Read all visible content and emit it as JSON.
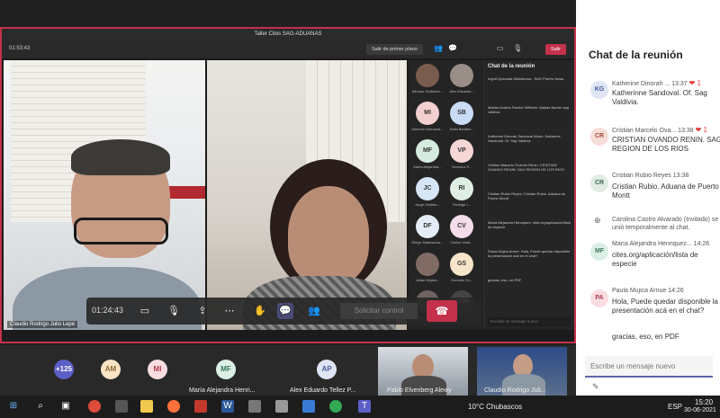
{
  "meeting_window": {
    "title": "Taller Cites SAG-ADUANAS",
    "timer": "01:53:43",
    "exit_fullscreen_label": "Salir de primer plano",
    "leave_label": "Salir"
  },
  "videos": {
    "left_name": "Claudio Rodrigo Julio Lepe",
    "right_name": ""
  },
  "controls": {
    "duration": "01:24:43",
    "request_control_label": "Solicitar control"
  },
  "gallery": {
    "tiles": [
      {
        "initials": "",
        "name": "Alfonso Gutierrez..."
      },
      {
        "initials": "",
        "name": "Alex Eduardo..."
      },
      {
        "initials": "MI",
        "name": "Marcela Hormazá..."
      },
      {
        "initials": "SB",
        "name": "Sofia Benitez..."
      },
      {
        "initials": "MF",
        "name": "María Alejandra..."
      },
      {
        "initials": "VP",
        "name": "Veronica P..."
      },
      {
        "initials": "JC",
        "name": "Jorge Cristian..."
      },
      {
        "initials": "RI",
        "name": "Rodrigo I..."
      },
      {
        "initials": "DF",
        "name": "Diego Salamanca..."
      },
      {
        "initials": "CV",
        "name": "Carlos Vladi..."
      },
      {
        "initials": "",
        "name": "Julian Mujica..."
      },
      {
        "initials": "GS",
        "name": "Gonzalo Ov..."
      },
      {
        "initials": "",
        "name": "Edith Maura..."
      },
      {
        "initials": "+100",
        "name": ""
      }
    ]
  },
  "inner_chat": {
    "title": "Chat de la reunión",
    "input_placeholder": "Escribe un mensaje nuevo",
    "messages": [
      "Ingrid Quezada Milantonea - SAG Puerto Varas",
      "Matías Andrés Fischer Wilhelm: Matías fischer sag valdivia",
      "Katherine Dinorah Sandoval Marín: Katherine Sandoval. Of. Sag Valdivia.",
      "Cristian Marcelo Ovando Renin: CRISTIAN OVANDO RENIN. SAG REGION DE LOS RIOS",
      "Cristian Rubio Reyes: Cristian Rubio. Aduana de Puerto Montt",
      "María Alejandra Henriquez: cites.org/aplicación/lista de especie",
      "Paula Mujica Arnue: Hola, Puede quedar disponible la presentación acá en el chat?",
      "gracias, eso, en PDF"
    ]
  },
  "participants_bar": {
    "overflow": "+125",
    "people": [
      {
        "initials": "AM",
        "name": ""
      },
      {
        "initials": "MI",
        "name": ""
      },
      {
        "initials": "MF",
        "name": "María Alejandra Henri..."
      },
      {
        "initials": "AP",
        "name": "Alex Eduardo Tellez P..."
      }
    ],
    "video_names": [
      "Pablo Elvenberg Alewy",
      "Claudio Rodrigo Juli..."
    ]
  },
  "chat": {
    "title": "Chat de la reunión",
    "input_placeholder": "Escribe un mensaje nuevo",
    "messages": [
      {
        "initials": "KG",
        "color": "#dfe5f5",
        "text_color": "#4a5a9a",
        "author": "Katherine Dinorah ...",
        "time": "13:37",
        "reaction": "❤ 1",
        "body": "Katherinne Sandoval. Of. Sag Valdivia."
      },
      {
        "initials": "CR",
        "color": "#f7ddd8",
        "text_color": "#a8473a",
        "author": "Cristian Marcelo Ova...",
        "time": "13:38",
        "reaction": "❤ 1",
        "body": "CRISTIAN OVANDO RENIN. SAG REGION DE LOS RIOS"
      },
      {
        "initials": "CR",
        "color": "#e0ece4",
        "text_color": "#3b6b4e",
        "author": "Cristian Rubio Reyes",
        "time": "13:38",
        "reaction": "",
        "body": "Cristian Rubio. Aduana de Puerto Montt"
      },
      {
        "initials": "MF",
        "color": "#dcefe6",
        "text_color": "#3a7a5c",
        "author": "María Alejandra Henriquez...",
        "time": "14:26",
        "reaction": "",
        "body": "cites.org/aplicación/lista de especie"
      },
      {
        "initials": "PA",
        "color": "#f9dde0",
        "text_color": "#b03a4d",
        "author": "Paula Mujica Arnue",
        "time": "14:26",
        "reaction": "",
        "body": "Hola, Puede quedar disponible la presentación acá en el chat?"
      }
    ],
    "system_message": "Carolina Castro Alvarado (Invitado) se unió temporalmente al chat.",
    "last_message": "gracias, eso, en PDF"
  },
  "taskbar": {
    "weather": "10°C Chubascos",
    "lang": "ESP",
    "time": "15:20",
    "date": "30-06-2021"
  }
}
